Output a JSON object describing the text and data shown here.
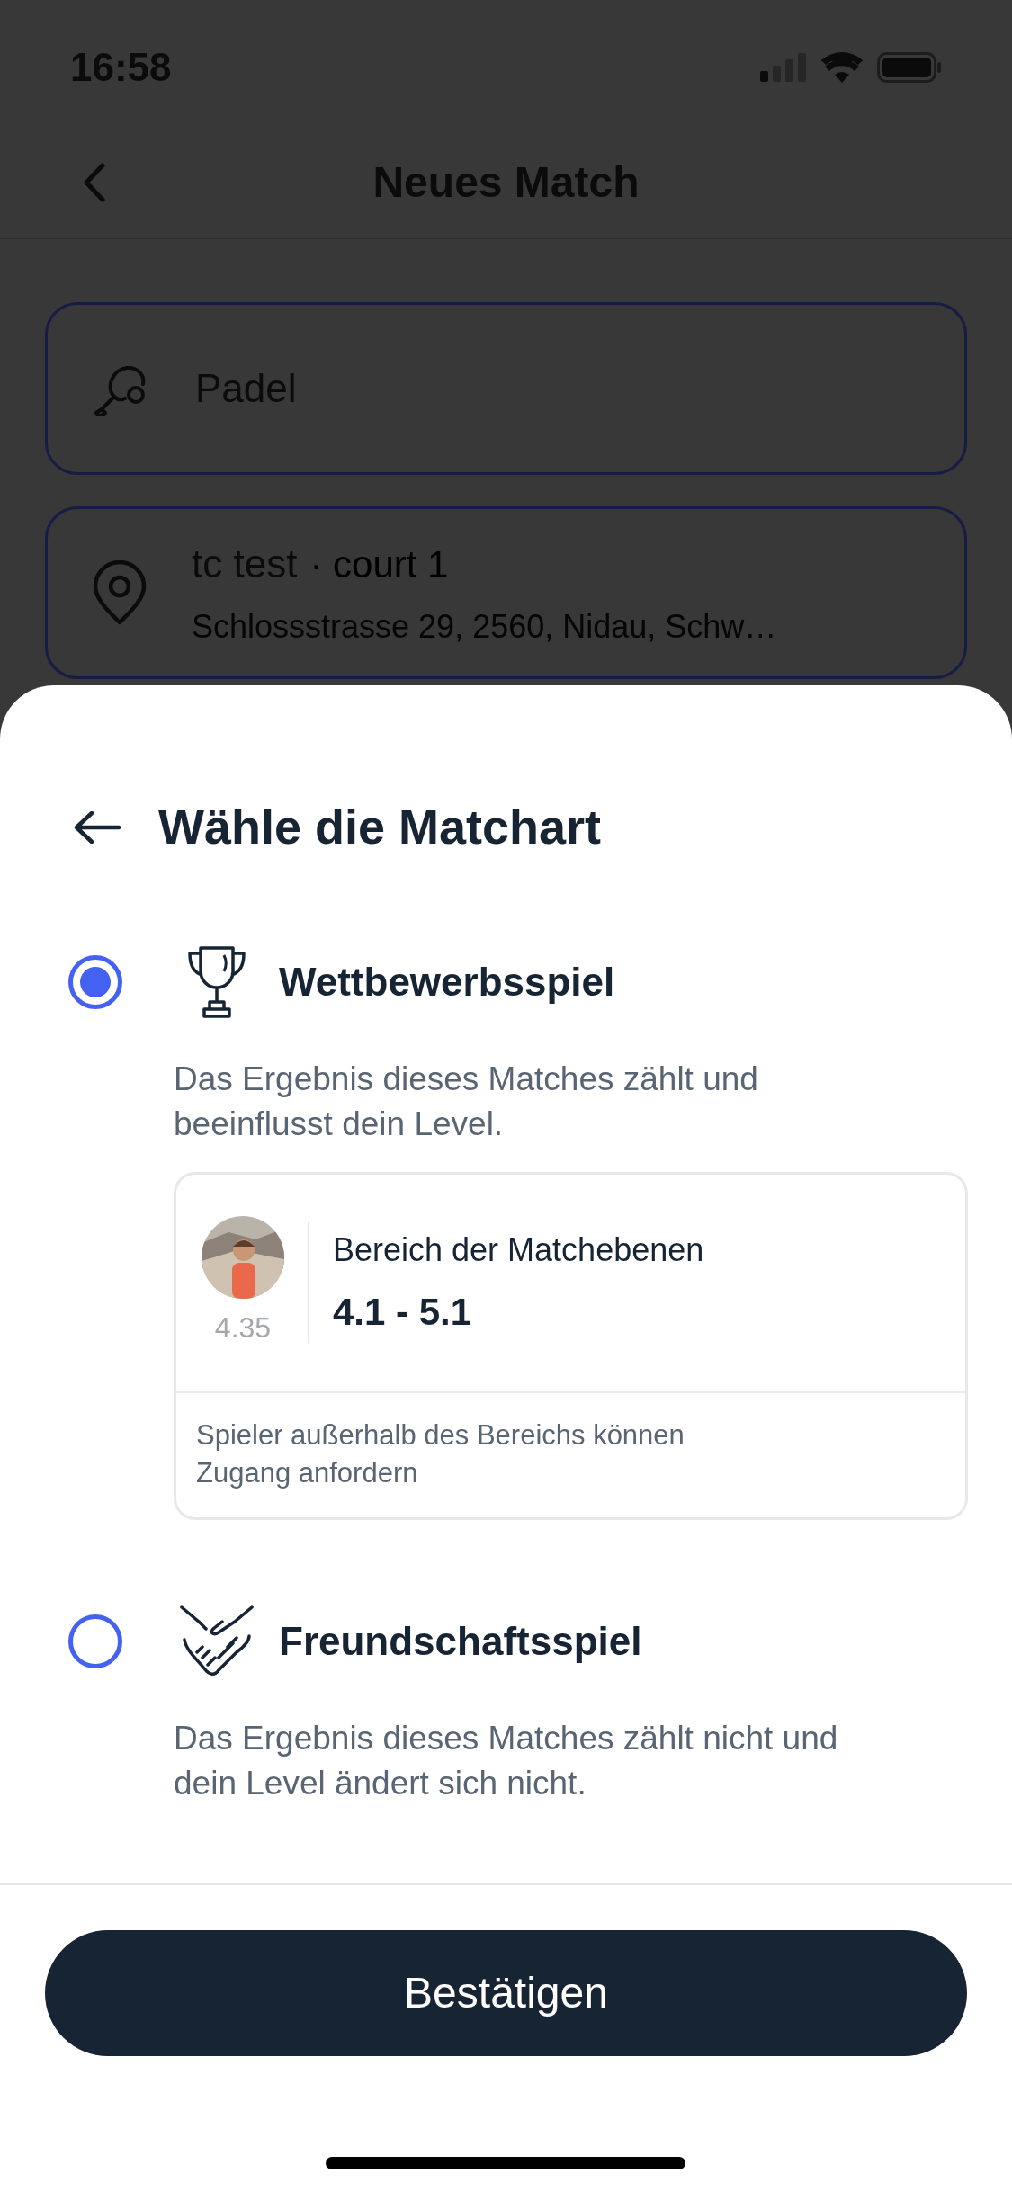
{
  "status_bar": {
    "time": "16:58"
  },
  "nav": {
    "title": "Neues Match"
  },
  "fields": [
    {
      "kind": "sport",
      "title": "Padel"
    },
    {
      "kind": "location",
      "title": "tc test",
      "detail": "· court 1",
      "address": "Schlossstrasse 29, 2560, Nidau, Schw…"
    }
  ],
  "sheet": {
    "title": "Wähle die Matchart",
    "options": [
      {
        "kind": "trophy",
        "title": "Wettbewerbsspiel",
        "description": "Das Ergebnis dieses Matches zählt und beeinflusst dein Level.",
        "selected": true,
        "range_card": {
          "player_rating": "4.35",
          "label": "Bereich der Matchebenen",
          "range": "4.1 - 5.1",
          "note": "Spieler außerhalb des Bereichs können Zugang anfordern"
        }
      },
      {
        "kind": "handshake",
        "title": "Freundschaftsspiel",
        "description": "Das Ergebnis dieses Matches zählt nicht und dein Level ändert sich nicht.",
        "selected": false
      }
    ],
    "confirm_button": "Bestätigen"
  }
}
